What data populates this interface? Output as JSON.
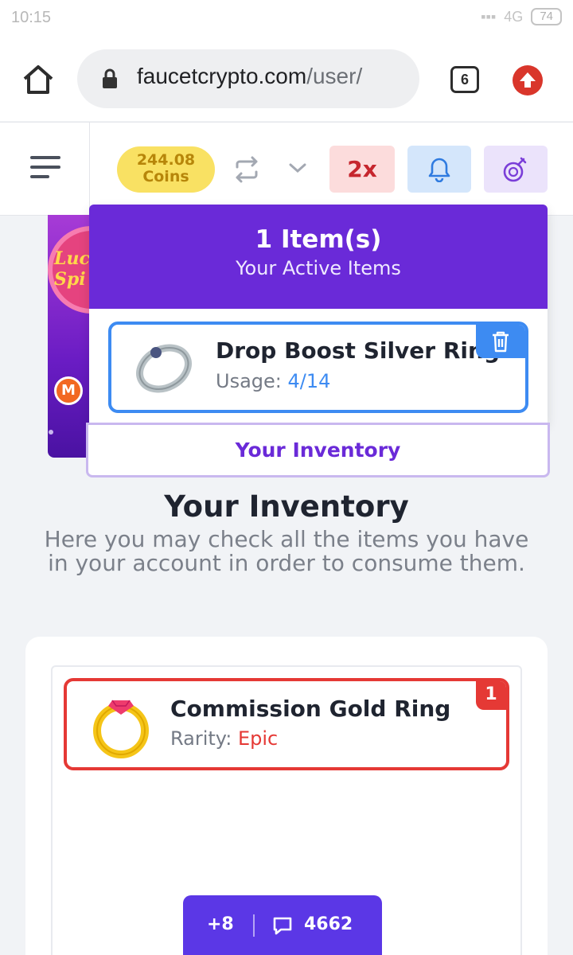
{
  "status_bar": {
    "time": "10:15",
    "network": "4G",
    "battery": "74"
  },
  "browser": {
    "url_domain": "faucetcrypto.com",
    "url_path": "/user/",
    "tab_count": "6"
  },
  "header": {
    "coins_amount": "244.08",
    "coins_label": "Coins",
    "multiplier": "2x"
  },
  "lucky_spin": {
    "text_line1": "Luck",
    "text_line2": "Spi"
  },
  "active_items": {
    "count_title": "1 Item(s)",
    "subtitle": "Your Active Items",
    "items": [
      {
        "name": "Drop Boost Silver Ring",
        "usage_label": "Usage:",
        "usage_value": "4/14"
      }
    ],
    "inventory_link": "Your Inventory"
  },
  "inventory": {
    "title": "Your Inventory",
    "description": "Here you may check all the items you have in your account in order to consume them.",
    "items": [
      {
        "name": "Commission Gold Ring",
        "rarity_label": "Rarity:",
        "rarity_value": "Epic",
        "quantity": "1"
      }
    ]
  },
  "chat": {
    "plus_count": "+8",
    "message_count": "4662"
  },
  "colors": {
    "brand_purple": "#6a2ad8",
    "active_blue": "#3d8bf2",
    "epic_red": "#e53935",
    "coins_yellow": "#f9e163"
  },
  "icons": [
    "home-icon",
    "lock-icon",
    "tabs-icon",
    "update-icon",
    "menu-icon",
    "swap-icon",
    "chevron-down-icon",
    "bell-icon",
    "potion-icon",
    "trash-icon",
    "silver-ring-icon",
    "gold-ring-icon",
    "chat-icon"
  ]
}
